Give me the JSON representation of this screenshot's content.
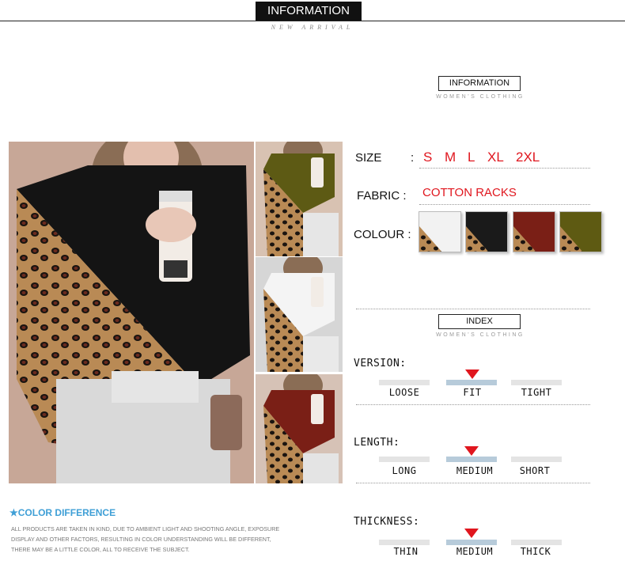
{
  "header": {
    "banner_title": "INFORMATION",
    "subtitle": "NEW ARRIVAL"
  },
  "information_block": {
    "title": "INFORMATION",
    "caption": "WOMEN'S CLOTHING"
  },
  "product_info": {
    "size_label": "SIZE",
    "size_sep": ":",
    "sizes": [
      "S",
      "M",
      "L",
      "XL",
      "2XL"
    ],
    "fabric_label": "FABRIC :",
    "fabric_value": "COTTON RACKS",
    "colour_label": "COLOUR :",
    "colours": [
      {
        "name": "white",
        "hex": "#f2f2f2"
      },
      {
        "name": "black",
        "hex": "#1a1a1a"
      },
      {
        "name": "wine-red",
        "hex": "#7a1f16"
      },
      {
        "name": "army-green",
        "hex": "#5e5a12"
      }
    ]
  },
  "index_block": {
    "title": "INDEX",
    "caption": "WOMEN'S CLOTHING"
  },
  "scales": [
    {
      "label": "VERSION:",
      "options": [
        "LOOSE",
        "FIT",
        "TIGHT"
      ],
      "selected": 1
    },
    {
      "label": "LENGTH:",
      "options": [
        "LONG",
        "MEDIUM",
        "SHORT"
      ],
      "selected": 1
    },
    {
      "label": "THICKNESS:",
      "options": [
        "THIN",
        "MEDIUM",
        "THICK"
      ],
      "selected": 1
    }
  ],
  "color_difference": {
    "title": "★COLOR DIFFERENCE",
    "lines": [
      "ALL PRODUCTS ARE TAKEN IN KIND, DUE TO AMBIENT LIGHT AND SHOOTING ANGLE, EXPOSURE",
      "DISPLAY AND OTHER FACTORS, RESULTING IN COLOR UNDERSTANDING WILL BE DIFFERENT,",
      "THERE MAY BE A LITTLE COLOR, ALL TO RECEIVE THE SUBJECT."
    ]
  },
  "colors": {
    "accent_red": "#e0161e",
    "scale_active": "#b7cbda",
    "scale_inactive": "#e4e4e4",
    "note_blue": "#3f9fd6"
  }
}
